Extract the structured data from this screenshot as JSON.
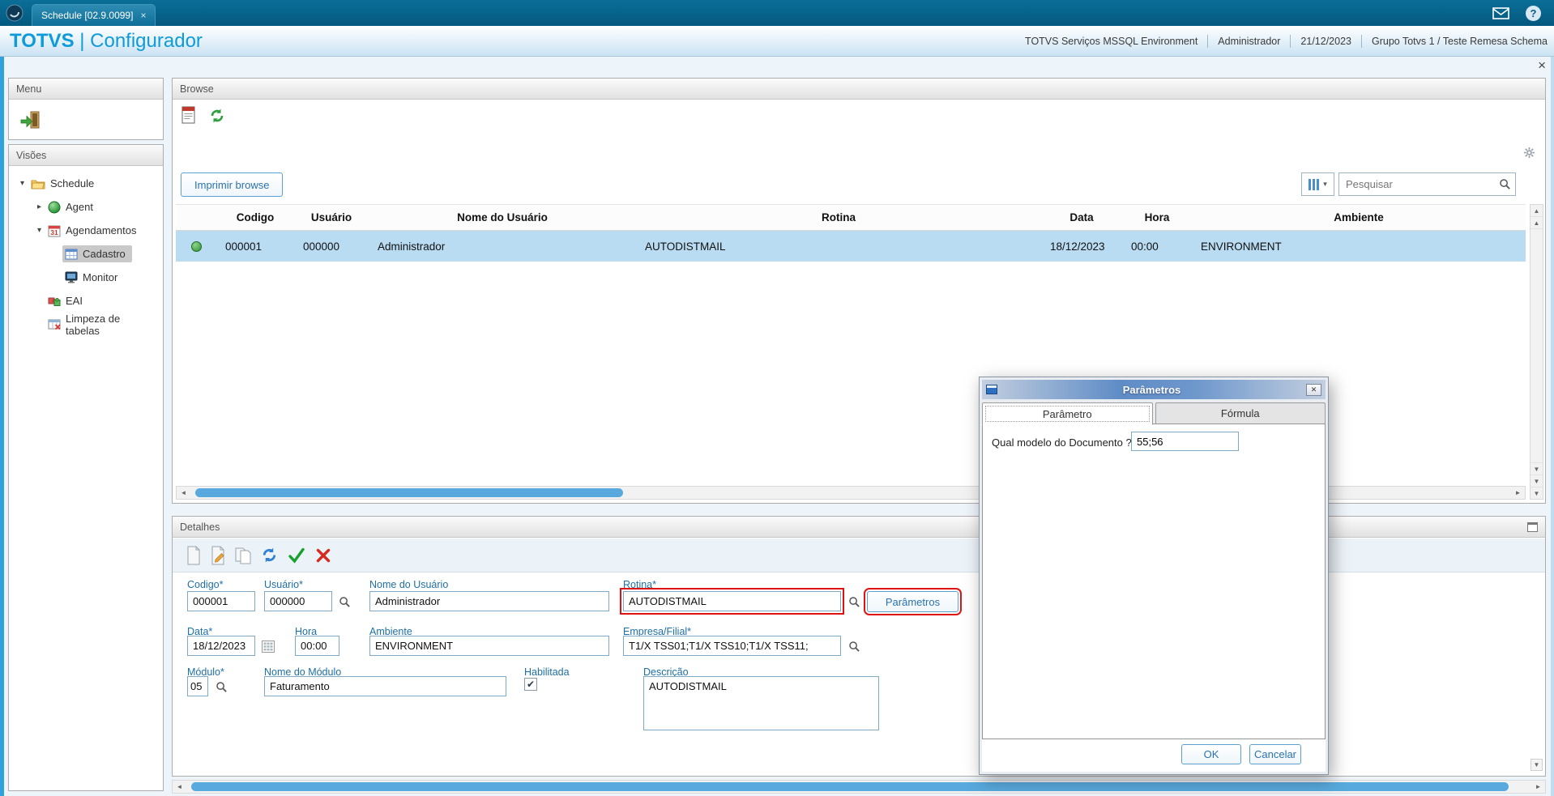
{
  "colors": {
    "brand_blue": "#0F9BD7",
    "topbar_blue": "#04618B",
    "selection_blue": "#B9DCF2",
    "status_green": "#3BA33B",
    "highlight_red": "#E01313"
  },
  "icons": {
    "tab_close": "×",
    "window_close": "×",
    "help": "?",
    "dialog_close": "✕",
    "check_mark": "✔"
  },
  "topbar": {
    "tab_label": "Schedule [02.9.0099]"
  },
  "header": {
    "brand": "TOTVS",
    "separator": "|",
    "app_name": "Configurador",
    "env_items": [
      "TOTVS Serviços MSSQL Environment",
      "Administrador",
      "21/12/2023",
      "Grupo Totvs 1 / Teste Remesa Schema"
    ]
  },
  "sidebar": {
    "menu_title": "Menu",
    "views_title": "Visões",
    "tree": [
      {
        "label": "Schedule"
      },
      {
        "label": "Agent"
      },
      {
        "label": "Agendamentos"
      },
      {
        "label": "Cadastro"
      },
      {
        "label": "Monitor"
      },
      {
        "label": "EAI"
      },
      {
        "label": "Limpeza de tabelas"
      }
    ]
  },
  "browse": {
    "panel_title": "Browse",
    "print_button": "Imprimir browse",
    "search_placeholder": "Pesquisar",
    "columns": [
      "Codigo",
      "Usuário",
      "Nome do Usuário",
      "Rotina",
      "Data",
      "Hora",
      "Ambiente"
    ],
    "rows": [
      {
        "codigo": "000001",
        "usuario": "000000",
        "nome_usuario": "Administrador",
        "rotina": "AUTODISTMAIL",
        "data": "18/12/2023",
        "hora": "00:00",
        "ambiente": "ENVIRONMENT"
      }
    ]
  },
  "detalhes": {
    "panel_title": "Detalhes",
    "codigo_label": "Codigo*",
    "codigo_value": "000001",
    "usuario_label": "Usuário*",
    "usuario_value": "000000",
    "nome_usuario_label": "Nome do Usuário",
    "nome_usuario_value": "Administrador",
    "rotina_label": "Rotina*",
    "rotina_value": "AUTODISTMAIL",
    "parametros_button": "Parâmetros",
    "data_label": "Data*",
    "data_value": "18/12/2023",
    "hora_label": "Hora",
    "hora_value": "00:00",
    "ambiente_label": "Ambiente",
    "ambiente_value": "ENVIRONMENT",
    "empresa_label": "Empresa/Filial*",
    "empresa_value": "T1/X TSS01;T1/X TSS10;T1/X TSS11;",
    "modulo_label": "Módulo*",
    "modulo_value": "05",
    "nome_modulo_label": "Nome do Módulo",
    "nome_modulo_value": "Faturamento",
    "habilitada_label": "Habilitada",
    "descricao_label": "Descrição",
    "descricao_value": "AUTODISTMAIL"
  },
  "modal": {
    "title": "Parâmetros",
    "tab_parametro": "Parâmetro",
    "tab_formula": "Fórmula",
    "question_label": "Qual modelo do Documento ?",
    "question_value": "55;56",
    "ok_button": "OK",
    "cancel_button": "Cancelar"
  }
}
